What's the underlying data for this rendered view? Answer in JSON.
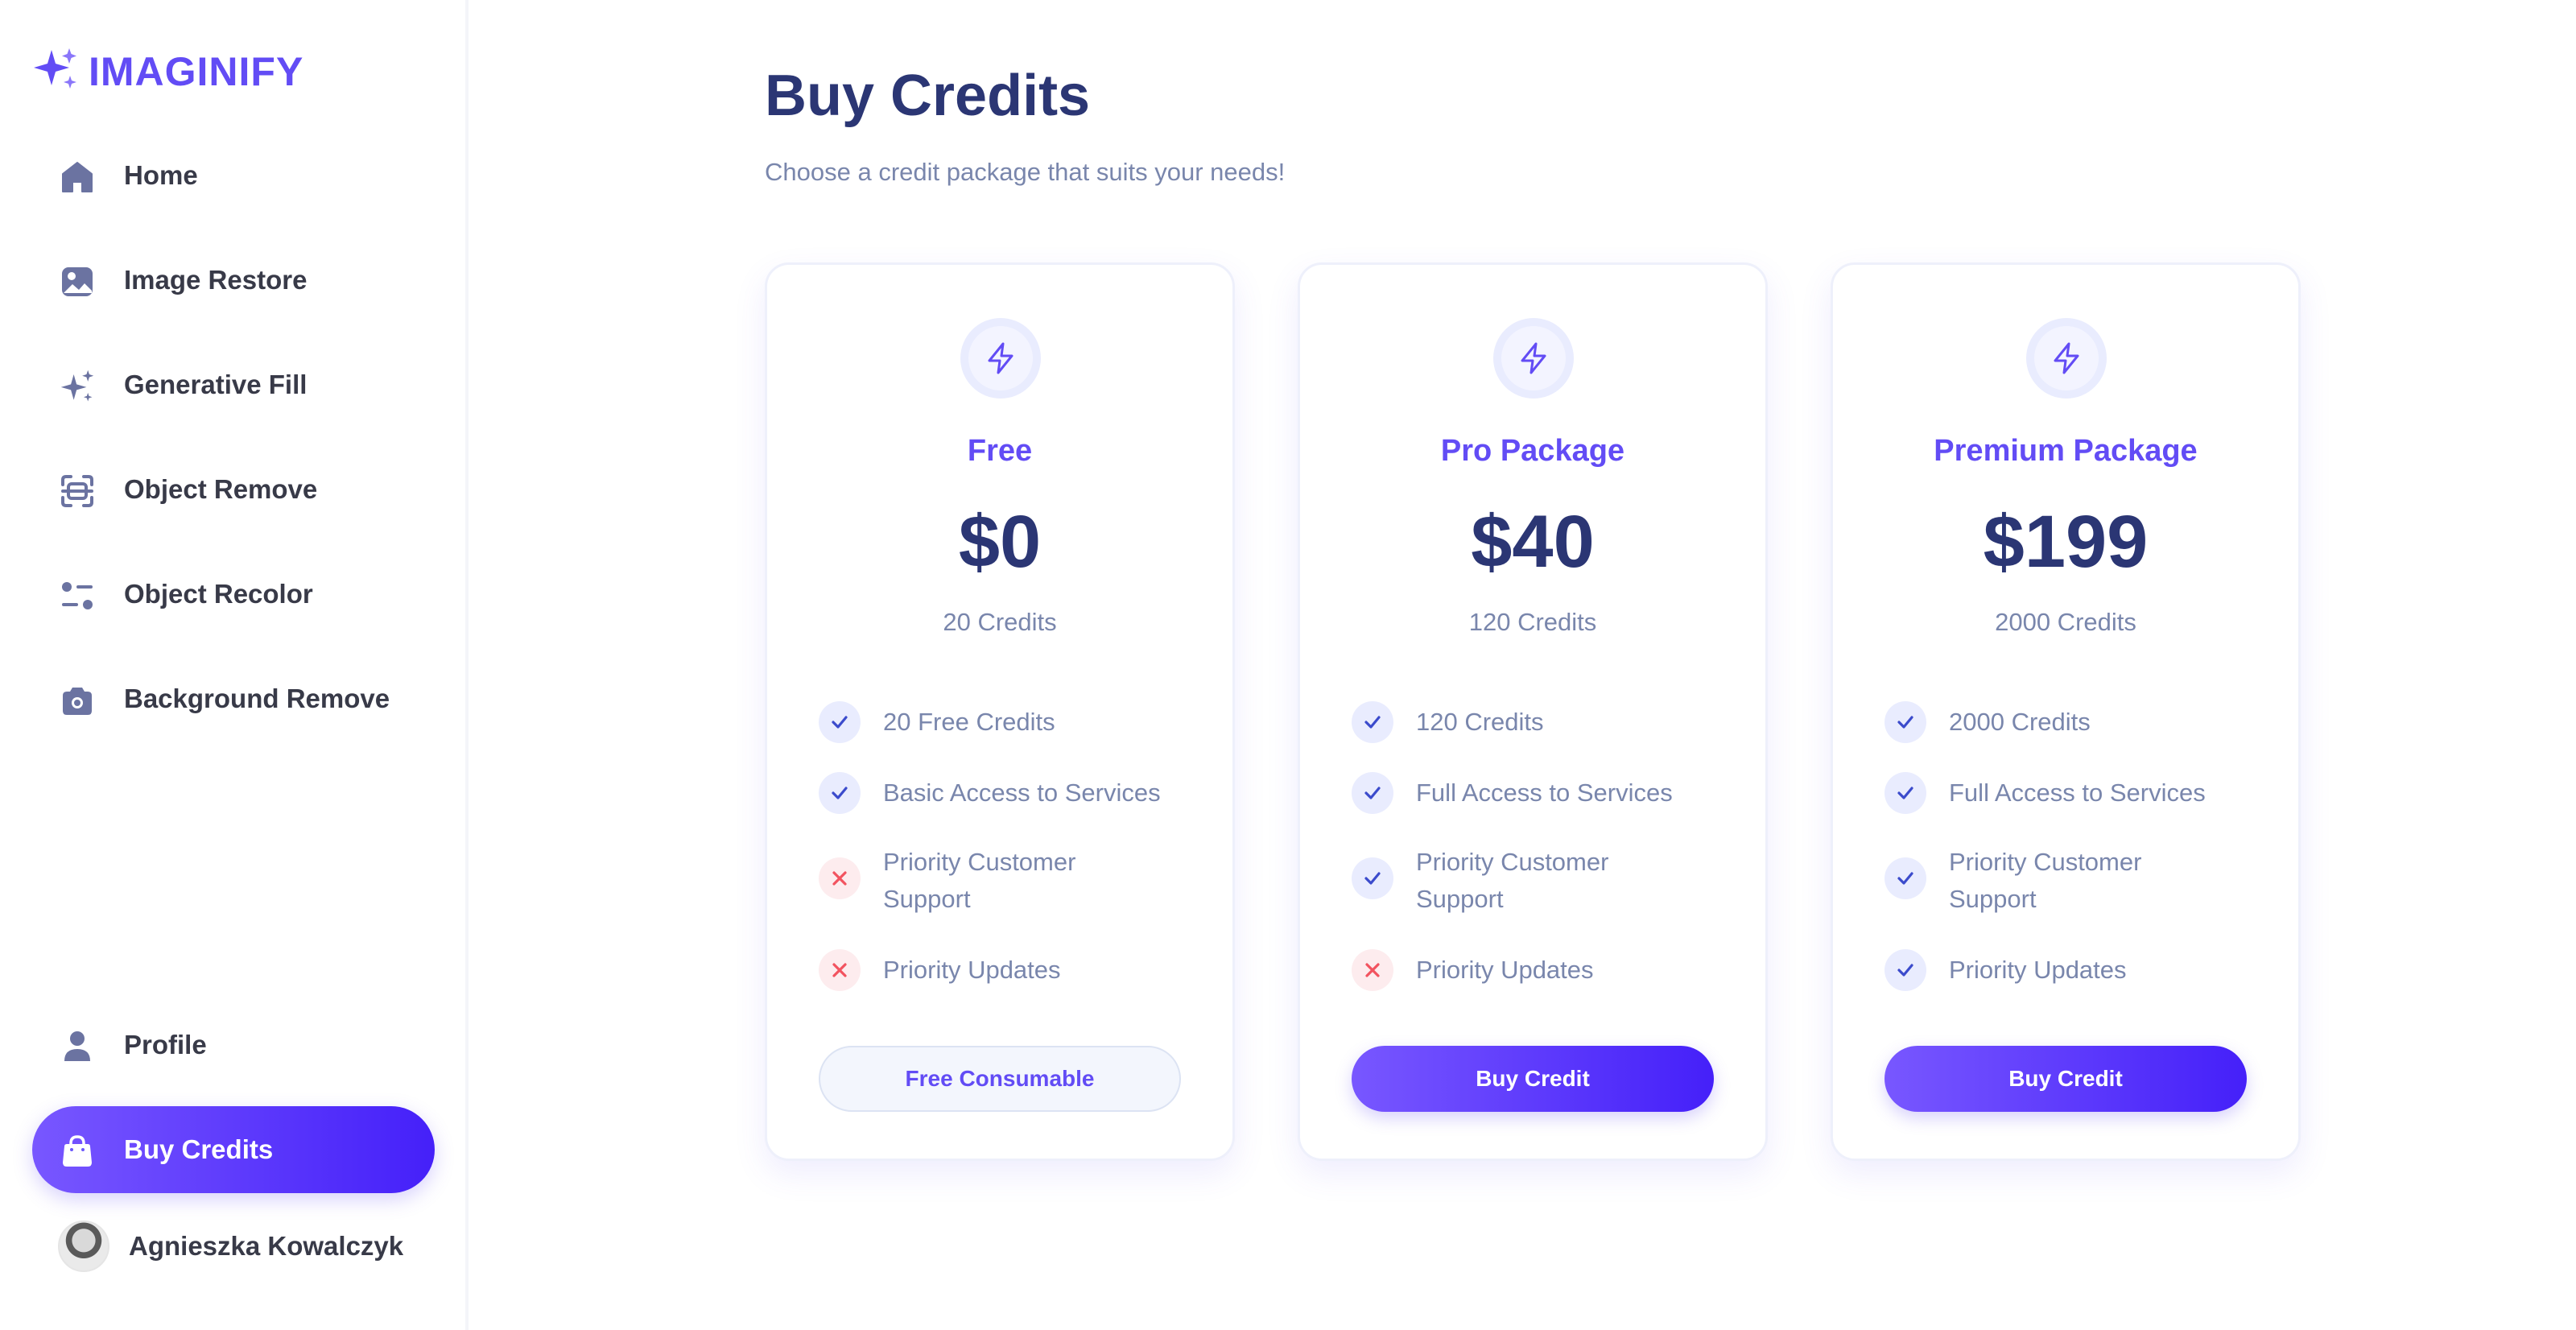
{
  "app": {
    "name": "IMAGINIFY"
  },
  "colors": {
    "brand": "#624CF5",
    "gradient_start": "#7857FF",
    "gradient_end": "#4520F9",
    "heading": "#2B3674",
    "muted": "#7986AC",
    "danger": "#F2535F"
  },
  "sidebar": {
    "items": [
      {
        "label": "Home",
        "icon": "home-icon"
      },
      {
        "label": "Image Restore",
        "icon": "image-icon"
      },
      {
        "label": "Generative Fill",
        "icon": "stars-icon"
      },
      {
        "label": "Object Remove",
        "icon": "scan-icon"
      },
      {
        "label": "Object Recolor",
        "icon": "filter-icon"
      },
      {
        "label": "Background Remove",
        "icon": "camera-icon"
      }
    ],
    "bottom_items": [
      {
        "label": "Profile",
        "icon": "profile-icon"
      },
      {
        "label": "Buy Credits",
        "icon": "bag-icon",
        "active": true
      }
    ],
    "user": {
      "name": "Agnieszka Kowalczyk"
    }
  },
  "page": {
    "title": "Buy Credits",
    "subtitle": "Choose a credit package that suits your needs!"
  },
  "plans": [
    {
      "name": "Free",
      "price": "$0",
      "credits": "20 Credits",
      "features": [
        {
          "label": "20 Free Credits",
          "included": true
        },
        {
          "label": "Basic Access to Services",
          "included": true
        },
        {
          "label": "Priority Customer Support",
          "included": false
        },
        {
          "label": "Priority Updates",
          "included": false
        }
      ],
      "button": "Free Consumable"
    },
    {
      "name": "Pro Package",
      "price": "$40",
      "credits": "120 Credits",
      "features": [
        {
          "label": "120 Credits",
          "included": true
        },
        {
          "label": "Full Access to Services",
          "included": true
        },
        {
          "label": "Priority Customer Support",
          "included": true
        },
        {
          "label": "Priority Updates",
          "included": false
        }
      ],
      "button": "Buy Credit"
    },
    {
      "name": "Premium Package",
      "price": "$199",
      "credits": "2000 Credits",
      "features": [
        {
          "label": "2000 Credits",
          "included": true
        },
        {
          "label": "Full Access to Services",
          "included": true
        },
        {
          "label": "Priority Customer Support",
          "included": true
        },
        {
          "label": "Priority Updates",
          "included": true
        }
      ],
      "button": "Buy Credit"
    }
  ]
}
